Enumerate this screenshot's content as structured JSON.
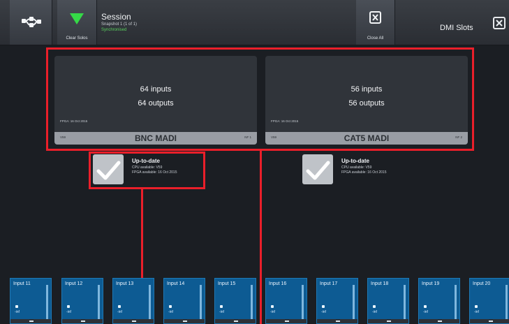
{
  "header": {
    "clear_solos_label": "Clear Solos",
    "session_title": "Session",
    "session_subtitle": "Snapshot 1 (1 of 1)",
    "session_status": "Synchronised",
    "clear_all_label": "Close All",
    "dmi_title": "DMI Slots"
  },
  "slots": [
    {
      "inputs": "64 inputs",
      "outputs": "64 outputs",
      "fpga": "FPGA: 16 Oct 2015",
      "footer_left": "V59",
      "name": "BNC MADI",
      "footer_right": "NF 1"
    },
    {
      "inputs": "56 inputs",
      "outputs": "56 outputs",
      "fpga": "FPGA: 16 Oct 2015",
      "footer_left": "V59",
      "name": "CAT5 MADI",
      "footer_right": "NF 2"
    }
  ],
  "status": [
    {
      "title": "Up-to-date",
      "line1": "CPU available: V59",
      "line2": "FPGA available: 16 Oct 2015"
    },
    {
      "title": "Up-to-date",
      "line1": "CPU available: V59",
      "line2": "FPGA available: 16 Oct 2015"
    }
  ],
  "inputs": [
    {
      "label": "Input 11",
      "value": "-inf"
    },
    {
      "label": "Input 12",
      "value": "-inf"
    },
    {
      "label": "Input 13",
      "value": "-inf"
    },
    {
      "label": "Input 14",
      "value": "-inf"
    },
    {
      "label": "Input 15",
      "value": "-inf"
    },
    {
      "label": "Input 16",
      "value": "-inf"
    },
    {
      "label": "Input 17",
      "value": "-inf"
    },
    {
      "label": "Input 18",
      "value": "-inf"
    },
    {
      "label": "Input 19",
      "value": "-inf"
    },
    {
      "label": "Input 20",
      "value": "-inf"
    }
  ],
  "colors": {
    "accent_red": "#ea1f2a",
    "input_blue": "#0d5b93",
    "status_green": "#59d15d"
  },
  "icons": {
    "network": "network-icon",
    "clear_solos": "green-triangle-icon",
    "close_all": "close-all-icon",
    "dmi_close": "close-icon",
    "status_check": "check-icon"
  }
}
